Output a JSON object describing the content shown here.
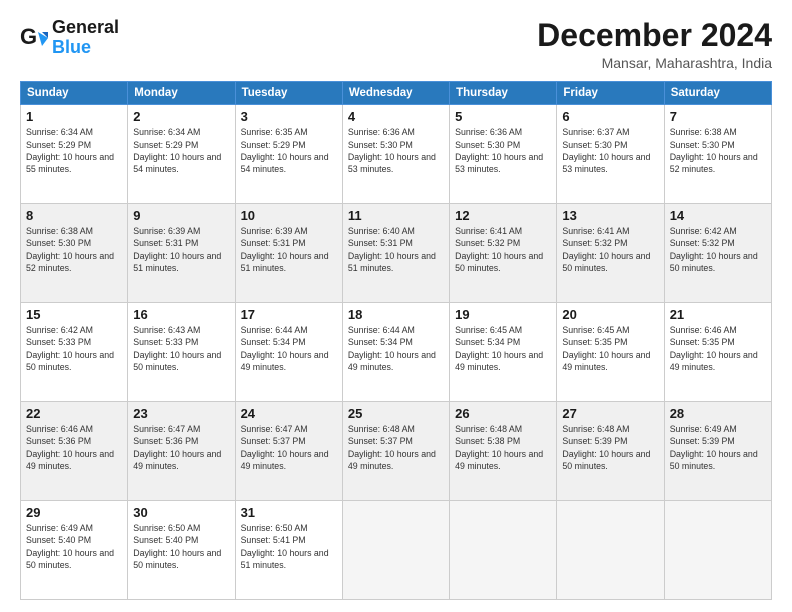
{
  "header": {
    "logo_line1": "General",
    "logo_line2": "Blue",
    "month_year": "December 2024",
    "location": "Mansar, Maharashtra, India"
  },
  "weekdays": [
    "Sunday",
    "Monday",
    "Tuesday",
    "Wednesday",
    "Thursday",
    "Friday",
    "Saturday"
  ],
  "weeks": [
    [
      {
        "day": "1",
        "sunrise": "6:34 AM",
        "sunset": "5:29 PM",
        "daylight": "10 hours and 55 minutes."
      },
      {
        "day": "2",
        "sunrise": "6:34 AM",
        "sunset": "5:29 PM",
        "daylight": "10 hours and 54 minutes."
      },
      {
        "day": "3",
        "sunrise": "6:35 AM",
        "sunset": "5:29 PM",
        "daylight": "10 hours and 54 minutes."
      },
      {
        "day": "4",
        "sunrise": "6:36 AM",
        "sunset": "5:30 PM",
        "daylight": "10 hours and 53 minutes."
      },
      {
        "day": "5",
        "sunrise": "6:36 AM",
        "sunset": "5:30 PM",
        "daylight": "10 hours and 53 minutes."
      },
      {
        "day": "6",
        "sunrise": "6:37 AM",
        "sunset": "5:30 PM",
        "daylight": "10 hours and 53 minutes."
      },
      {
        "day": "7",
        "sunrise": "6:38 AM",
        "sunset": "5:30 PM",
        "daylight": "10 hours and 52 minutes."
      }
    ],
    [
      {
        "day": "8",
        "sunrise": "6:38 AM",
        "sunset": "5:30 PM",
        "daylight": "10 hours and 52 minutes."
      },
      {
        "day": "9",
        "sunrise": "6:39 AM",
        "sunset": "5:31 PM",
        "daylight": "10 hours and 51 minutes."
      },
      {
        "day": "10",
        "sunrise": "6:39 AM",
        "sunset": "5:31 PM",
        "daylight": "10 hours and 51 minutes."
      },
      {
        "day": "11",
        "sunrise": "6:40 AM",
        "sunset": "5:31 PM",
        "daylight": "10 hours and 51 minutes."
      },
      {
        "day": "12",
        "sunrise": "6:41 AM",
        "sunset": "5:32 PM",
        "daylight": "10 hours and 50 minutes."
      },
      {
        "day": "13",
        "sunrise": "6:41 AM",
        "sunset": "5:32 PM",
        "daylight": "10 hours and 50 minutes."
      },
      {
        "day": "14",
        "sunrise": "6:42 AM",
        "sunset": "5:32 PM",
        "daylight": "10 hours and 50 minutes."
      }
    ],
    [
      {
        "day": "15",
        "sunrise": "6:42 AM",
        "sunset": "5:33 PM",
        "daylight": "10 hours and 50 minutes."
      },
      {
        "day": "16",
        "sunrise": "6:43 AM",
        "sunset": "5:33 PM",
        "daylight": "10 hours and 50 minutes."
      },
      {
        "day": "17",
        "sunrise": "6:44 AM",
        "sunset": "5:34 PM",
        "daylight": "10 hours and 49 minutes."
      },
      {
        "day": "18",
        "sunrise": "6:44 AM",
        "sunset": "5:34 PM",
        "daylight": "10 hours and 49 minutes."
      },
      {
        "day": "19",
        "sunrise": "6:45 AM",
        "sunset": "5:34 PM",
        "daylight": "10 hours and 49 minutes."
      },
      {
        "day": "20",
        "sunrise": "6:45 AM",
        "sunset": "5:35 PM",
        "daylight": "10 hours and 49 minutes."
      },
      {
        "day": "21",
        "sunrise": "6:46 AM",
        "sunset": "5:35 PM",
        "daylight": "10 hours and 49 minutes."
      }
    ],
    [
      {
        "day": "22",
        "sunrise": "6:46 AM",
        "sunset": "5:36 PM",
        "daylight": "10 hours and 49 minutes."
      },
      {
        "day": "23",
        "sunrise": "6:47 AM",
        "sunset": "5:36 PM",
        "daylight": "10 hours and 49 minutes."
      },
      {
        "day": "24",
        "sunrise": "6:47 AM",
        "sunset": "5:37 PM",
        "daylight": "10 hours and 49 minutes."
      },
      {
        "day": "25",
        "sunrise": "6:48 AM",
        "sunset": "5:37 PM",
        "daylight": "10 hours and 49 minutes."
      },
      {
        "day": "26",
        "sunrise": "6:48 AM",
        "sunset": "5:38 PM",
        "daylight": "10 hours and 49 minutes."
      },
      {
        "day": "27",
        "sunrise": "6:48 AM",
        "sunset": "5:39 PM",
        "daylight": "10 hours and 50 minutes."
      },
      {
        "day": "28",
        "sunrise": "6:49 AM",
        "sunset": "5:39 PM",
        "daylight": "10 hours and 50 minutes."
      }
    ],
    [
      {
        "day": "29",
        "sunrise": "6:49 AM",
        "sunset": "5:40 PM",
        "daylight": "10 hours and 50 minutes."
      },
      {
        "day": "30",
        "sunrise": "6:50 AM",
        "sunset": "5:40 PM",
        "daylight": "10 hours and 50 minutes."
      },
      {
        "day": "31",
        "sunrise": "6:50 AM",
        "sunset": "5:41 PM",
        "daylight": "10 hours and 51 minutes."
      },
      null,
      null,
      null,
      null
    ]
  ]
}
